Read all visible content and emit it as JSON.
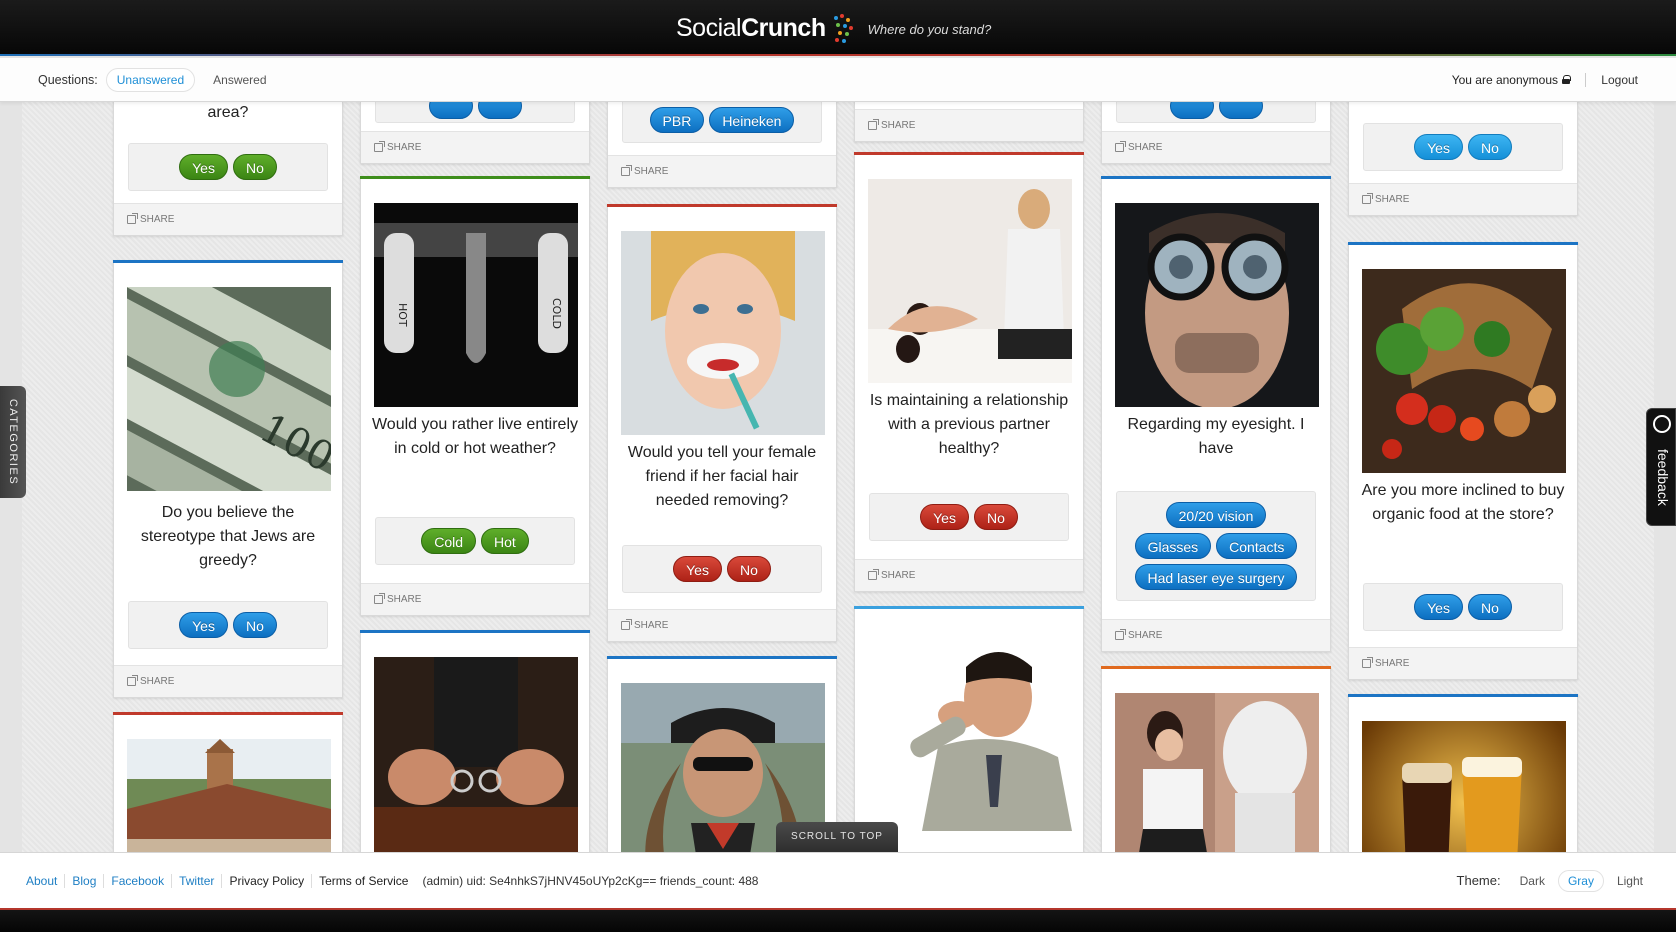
{
  "header": {
    "logo_light": "Social",
    "logo_bold": "Crunch",
    "tagline": "Where do you stand?"
  },
  "subbar": {
    "questions_label": "Questions:",
    "tab_unanswered": "Unanswered",
    "tab_answered": "Answered",
    "anon_text": "You are anonymous",
    "logout": "Logout"
  },
  "share_label": "SHARE",
  "cards": {
    "c1a": {
      "text": "area?",
      "answers": [
        "Yes",
        "No"
      ]
    },
    "c1b": {
      "text": "Do you believe the stereotype that Jews are greedy?",
      "answers": [
        "Yes",
        "No"
      ]
    },
    "c2a": {
      "answers": []
    },
    "c2b": {
      "text": "Would you rather live entirely in cold or hot weather?",
      "answers": [
        "Cold",
        "Hot"
      ]
    },
    "c3a": {
      "answers": [
        "PBR",
        "Heineken"
      ]
    },
    "c3b": {
      "text": "Would you tell your female friend if her facial hair needed removing?",
      "answers": [
        "Yes",
        "No"
      ]
    },
    "c4a": {
      "text": "Is maintaining a relationship with a previous partner healthy?",
      "answers": [
        "Yes",
        "No"
      ]
    },
    "c5b": {
      "text": "Regarding my eyesight. I have",
      "answers": [
        "20/20 vision",
        "Glasses",
        "Contacts",
        "Had laser eye surgery"
      ]
    },
    "c6a": {
      "answers": [
        "Yes",
        "No"
      ]
    },
    "c6b": {
      "text": "Are you more inclined to buy organic food at the store?",
      "answers": [
        "Yes",
        "No"
      ]
    }
  },
  "side": {
    "categories": "CATEGORIES",
    "feedback": "feedback",
    "scroll_top": "SCROLL TO TOP"
  },
  "footer": {
    "links": [
      "About",
      "Blog",
      "Facebook",
      "Twitter",
      "Privacy Policy",
      "Terms of Service"
    ],
    "admin": "(admin) uid: Se4nhkS7jHNV45oUYp2cKg== friends_count: 488",
    "theme_label": "Theme:",
    "themes": [
      "Dark",
      "Gray",
      "Light"
    ]
  }
}
